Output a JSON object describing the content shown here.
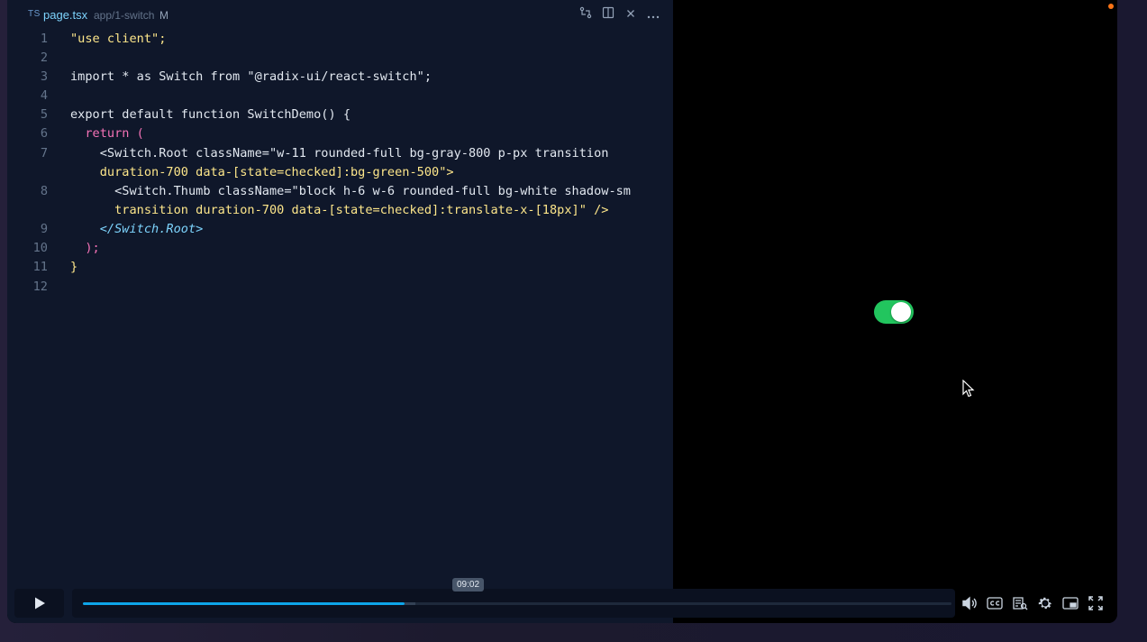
{
  "tab": {
    "lang_badge": "TS",
    "file_name": "page.tsx",
    "path": "app/1-switch",
    "modified": "M"
  },
  "code": {
    "line_numbers": [
      "1",
      "2",
      "3",
      "4",
      "5",
      "6",
      "7",
      "",
      "8",
      "",
      "9",
      "10",
      "11",
      "12"
    ],
    "lines": [
      "\"use client\";",
      "",
      "import * as Switch from \"@radix-ui/react-switch\";",
      "",
      "export default function SwitchDemo() {",
      "  return (",
      "    <Switch.Root className=\"w-11 rounded-full bg-gray-800 p-px transition",
      "    duration-700 data-[state=checked]:bg-green-500\">",
      "      <Switch.Thumb className=\"block h-6 w-6 rounded-full bg-white shadow-sm",
      "      transition duration-700 data-[state=checked]:translate-x-[18px]\" />",
      "    </Switch.Root>",
      "  );",
      "}",
      ""
    ]
  },
  "preview": {
    "switch_state": "checked",
    "switch_color": "#22c55e"
  },
  "player": {
    "time_tooltip": "09:02",
    "progress_fraction": 0.37,
    "icons": [
      "play-icon",
      "volume-icon",
      "captions-icon",
      "transcript-icon",
      "settings-icon",
      "pip-icon",
      "fullscreen-icon"
    ]
  },
  "colors": {
    "editor_bg": "#0f172a",
    "accent": "#0ea5e9"
  }
}
